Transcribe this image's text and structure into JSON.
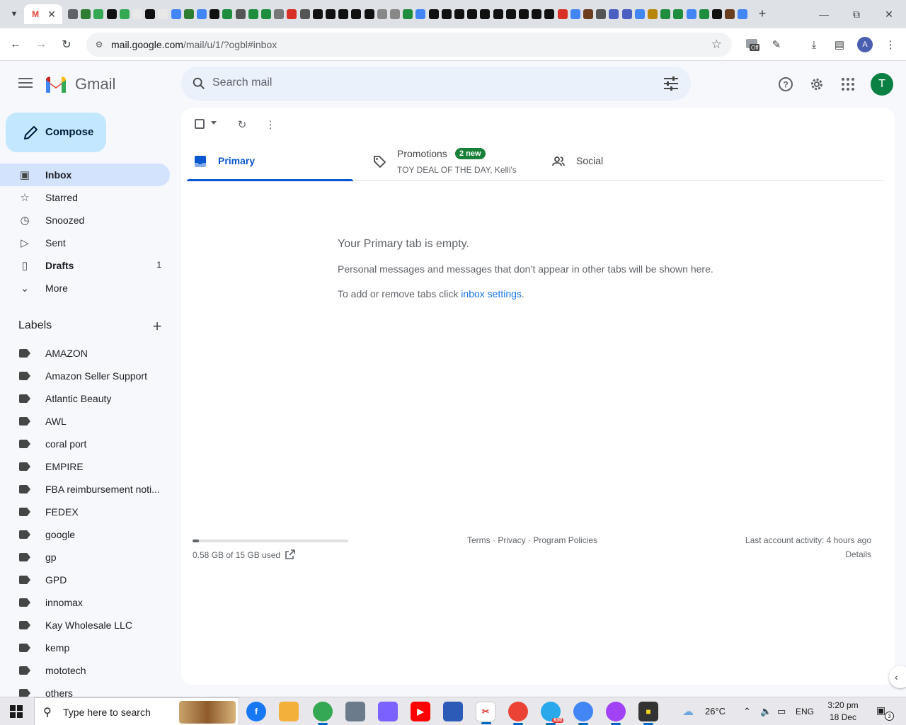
{
  "browser": {
    "active_tab_icon": "gmail-icon",
    "url_host": "mail.google.com",
    "url_path": "/mail/u/1/?ogbl#inbox",
    "profile_initial": "A",
    "extension_badge": "Off"
  },
  "gmail": {
    "product_name": "Gmail",
    "search_placeholder": "Search mail",
    "avatar_initial": "T",
    "compose_label": "Compose",
    "nav": [
      {
        "label": "Inbox",
        "icon": "inbox-icon",
        "count": ""
      },
      {
        "label": "Starred",
        "icon": "star-icon",
        "count": ""
      },
      {
        "label": "Snoozed",
        "icon": "clock-icon",
        "count": ""
      },
      {
        "label": "Sent",
        "icon": "send-icon",
        "count": ""
      },
      {
        "label": "Drafts",
        "icon": "draft-icon",
        "count": "1"
      },
      {
        "label": "More",
        "icon": "chevron-down-icon",
        "count": ""
      }
    ],
    "labels_header": "Labels",
    "labels": [
      "AMAZON",
      "Amazon Seller Support",
      "Atlantic Beauty",
      "AWL",
      "coral port",
      "EMPIRE",
      "FBA reimbursement noti...",
      "FEDEX",
      "google",
      "gp",
      "GPD",
      "innomax",
      "Kay Wholesale LLC",
      "kemp",
      "mototech",
      "others"
    ],
    "tabs": {
      "primary": "Primary",
      "promotions": "Promotions",
      "promotions_badge": "2 new",
      "promotions_sub": "TOY DEAL OF THE DAY, Kelli's",
      "social": "Social"
    },
    "empty": {
      "title": "Your Primary tab is empty.",
      "message": "Personal messages and messages that don’t appear in other tabs will be shown here.",
      "hint_prefix": "To add or remove tabs click ",
      "hint_link": "inbox settings",
      "hint_suffix": "."
    },
    "footer": {
      "storage": "0.58 GB of 15 GB used",
      "storage_fraction": 0.0387,
      "terms": "Terms",
      "privacy": "Privacy",
      "policies": "Program Policies",
      "sep": " · ",
      "activity": "Last account activity: 4 hours ago",
      "details": "Details"
    }
  },
  "taskbar": {
    "search_placeholder": "Type here to search",
    "weather": "26°C",
    "language": "ENG",
    "time": "3:20 pm",
    "date": "18 Dec 2023",
    "notifications": "3",
    "telegram_badge": "630"
  },
  "colors": {
    "accent": "#0b57d0",
    "compose_bg": "#c2e7ff",
    "active_nav_bg": "#d3e3fd",
    "badge_green": "#188038"
  }
}
